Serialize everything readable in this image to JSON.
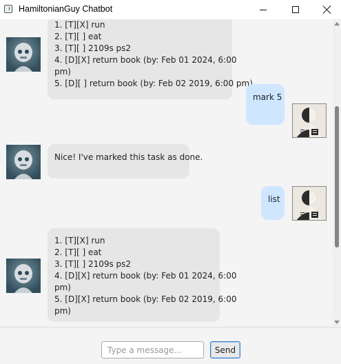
{
  "window": {
    "title": "HamiltonianGuy Chatbot"
  },
  "messages": [
    {
      "sender": "bot",
      "lines": [
        "1. [T][X] run",
        "2. [T][ ] eat",
        "3. [T][ ] 2109s ps2",
        "4. [D][X] return book (by: Feb 01 2024, 6:00",
        "pm)",
        "5. [D][ ] return book (by: Feb 02 2019, 6:00 pm)"
      ]
    },
    {
      "sender": "user",
      "lines": [
        "mark 5"
      ]
    },
    {
      "sender": "bot",
      "lines": [
        "Nice! I've marked this task as done."
      ]
    },
    {
      "sender": "user",
      "lines": [
        "list"
      ]
    },
    {
      "sender": "bot",
      "lines": [
        "1. [T][X] run",
        "2. [T][ ] eat",
        "3. [T][ ] 2109s ps2",
        "4. [D][X] return book (by: Feb 01 2024, 6:00",
        "pm)",
        "5. [D][X] return book (by: Feb 02 2019, 6:00",
        "pm)"
      ]
    }
  ],
  "input": {
    "placeholder": "Type a message...",
    "value": ""
  },
  "send_button": {
    "label": "Send"
  },
  "icons": {
    "bot_avatar": "robot-avatar-icon",
    "user_avatar": "user-avatar-icon"
  },
  "colors": {
    "bot_bubble": "#e6e6e6",
    "user_bubble": "#cfe6ff",
    "background": "#f4f4f4"
  }
}
